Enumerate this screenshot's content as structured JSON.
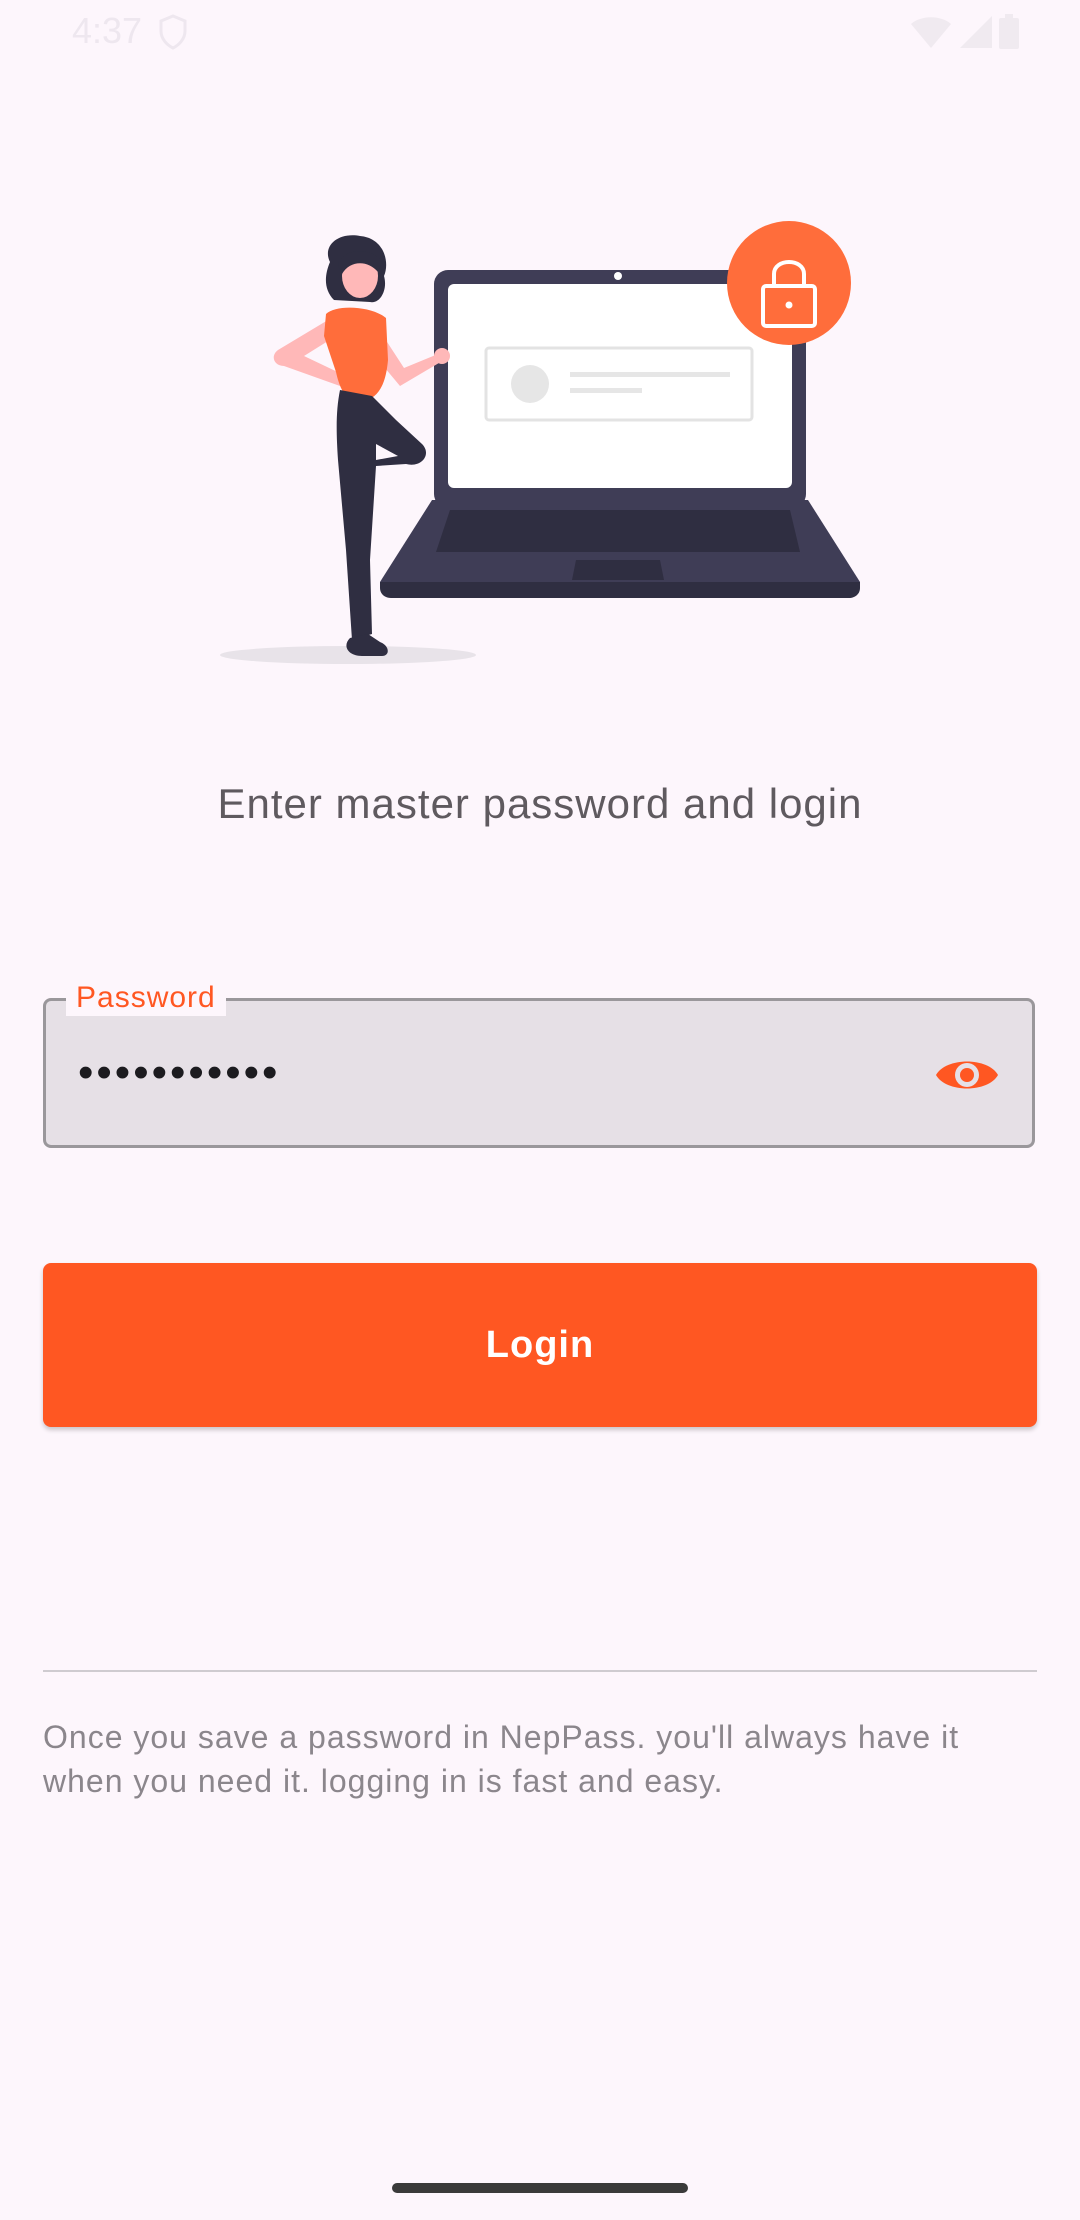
{
  "status_bar": {
    "time": "4:37",
    "icons": [
      "shield-icon",
      "wifi-icon",
      "signal-icon",
      "battery-icon"
    ]
  },
  "illustration": {
    "description_icon": "person-laptop-lock-illustration",
    "accent_color": "#ff6d3b"
  },
  "heading": "Enter master password and login",
  "password_field": {
    "label": "Password",
    "value": "•••••••••••",
    "toggle_icon": "eye-icon"
  },
  "login_button": {
    "label": "Login"
  },
  "info_text": "Once you save a password in NepPass. you'll always have it when you need it. logging in is fast and easy.",
  "colors": {
    "accent": "#ff5722",
    "background": "#fdf6fc",
    "field_background": "#e6e0e6"
  }
}
